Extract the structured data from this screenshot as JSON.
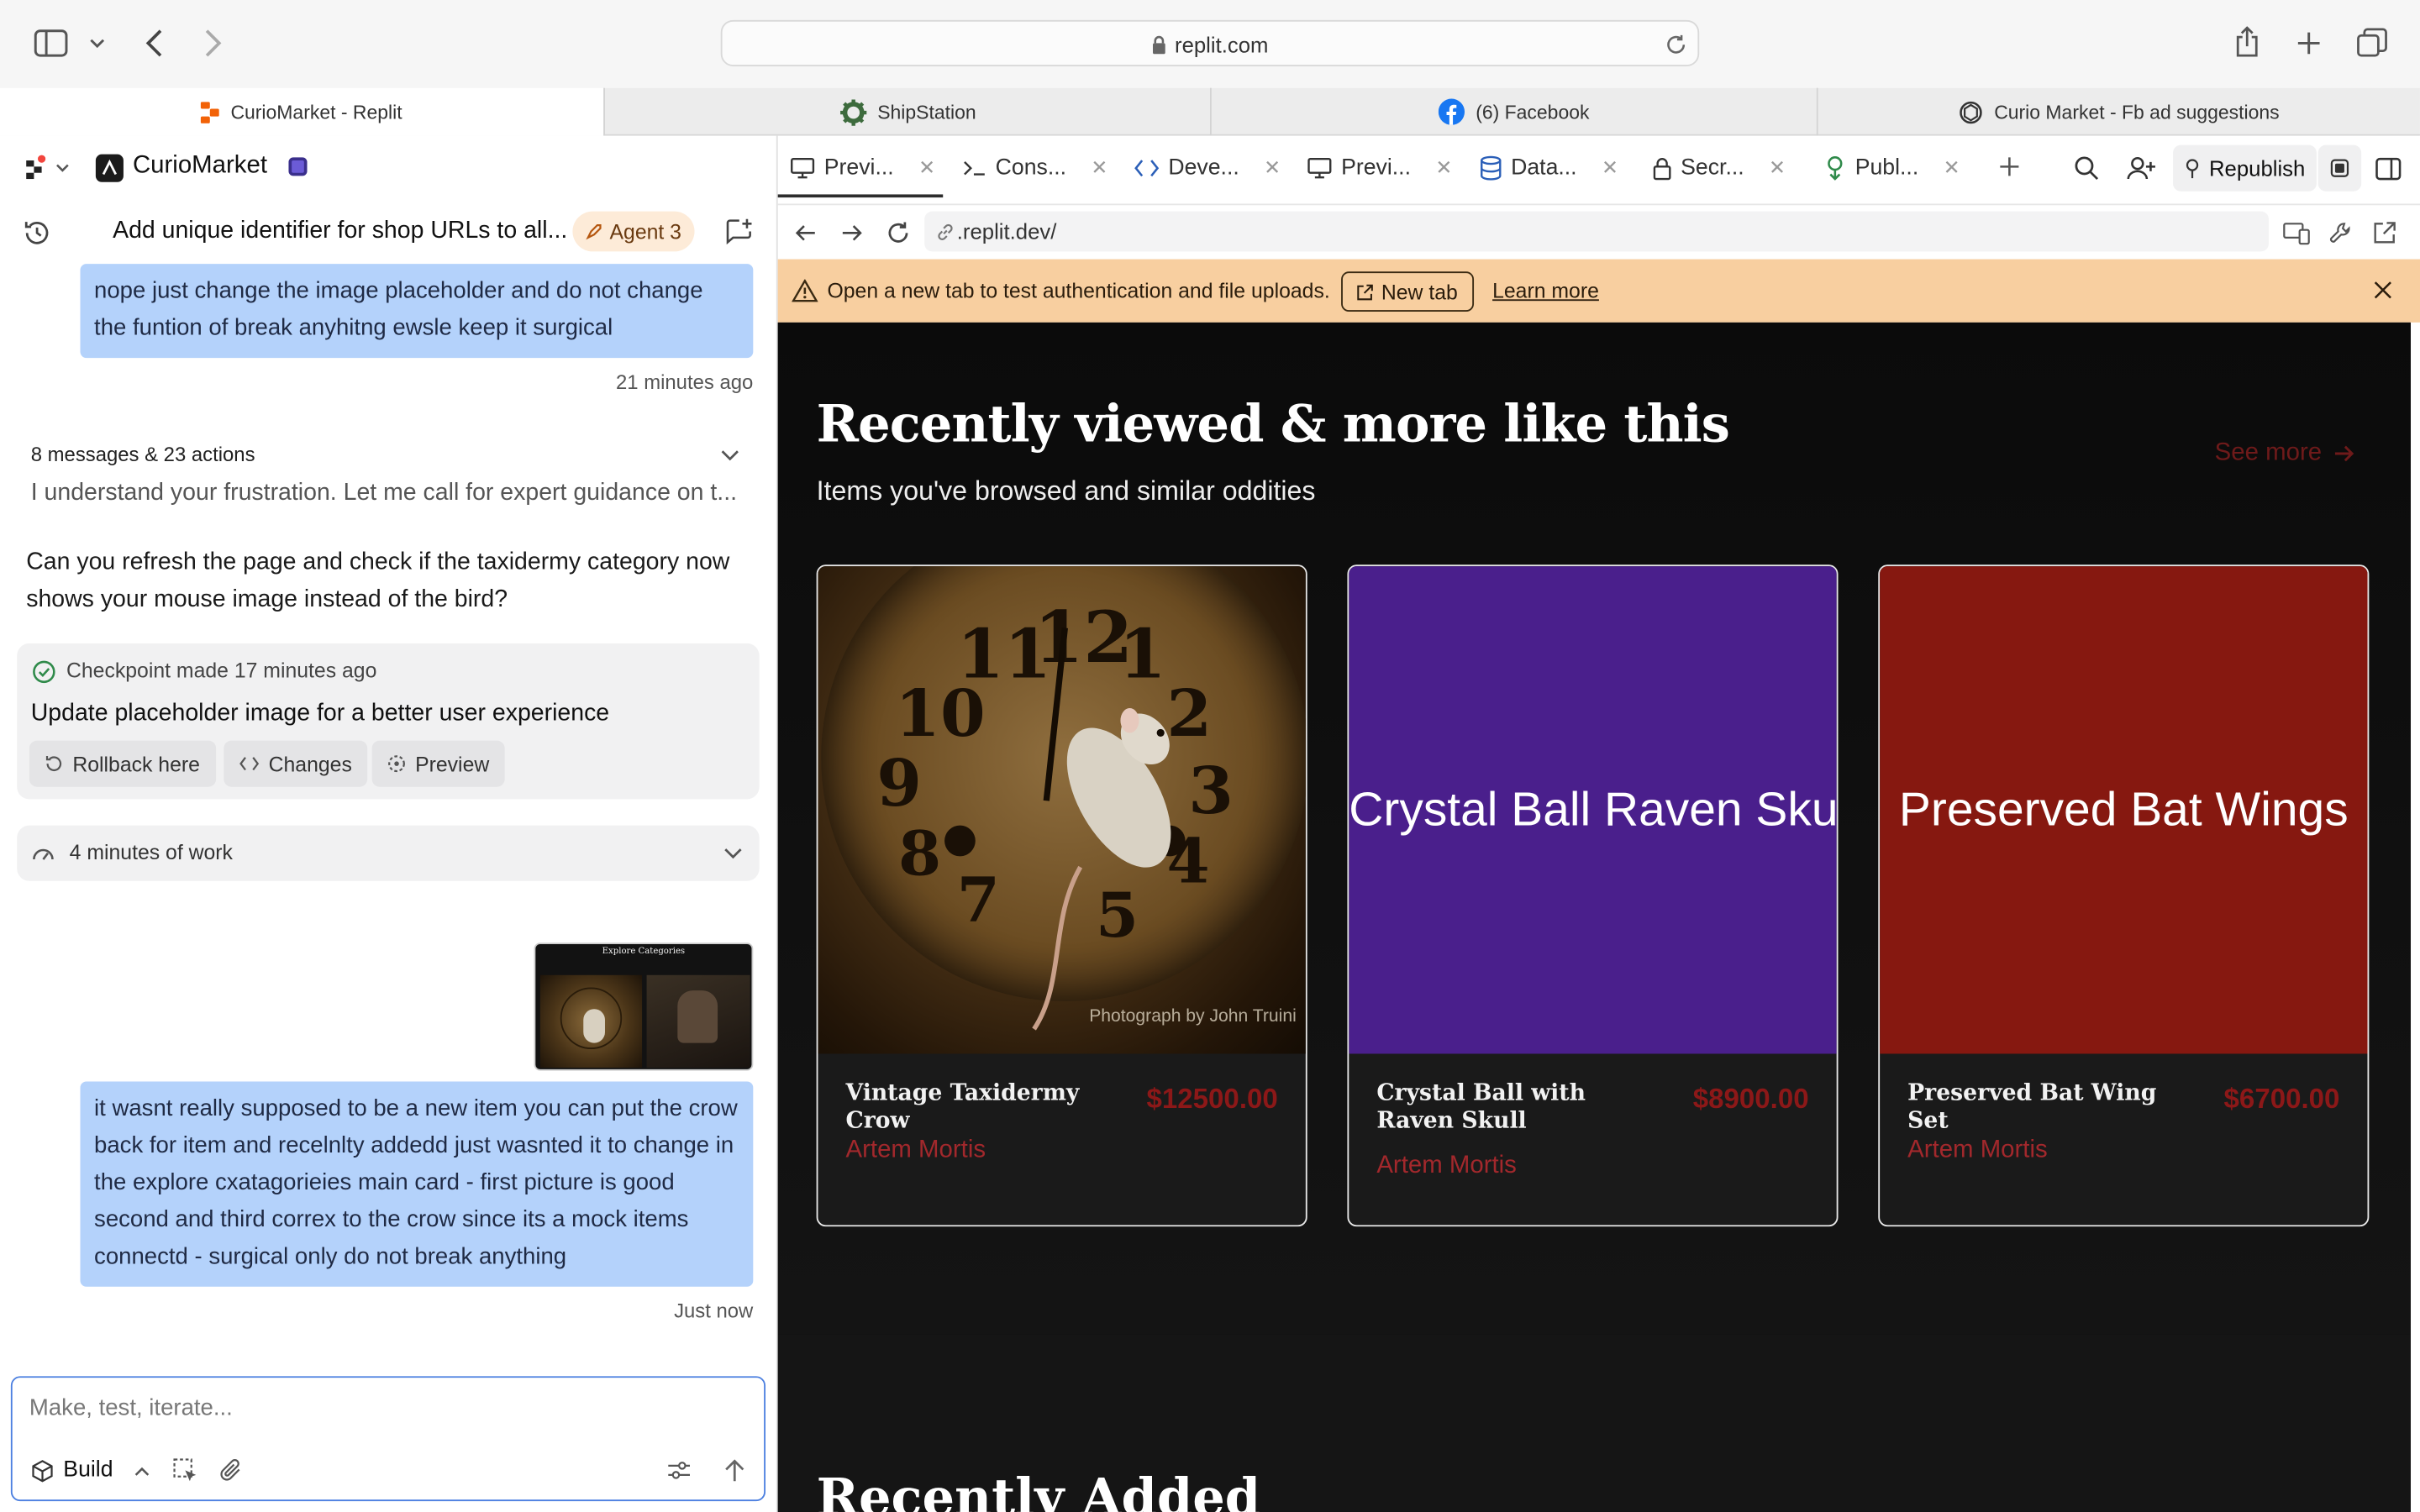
{
  "browser": {
    "url": "replit.com",
    "tabs": [
      {
        "label": "CurioMarket - Replit",
        "icon": "replit-icon",
        "active": true
      },
      {
        "label": "ShipStation",
        "icon": "gear-icon",
        "active": false
      },
      {
        "label": "(6) Facebook",
        "icon": "facebook-icon",
        "active": false
      },
      {
        "label": "Curio Market - Fb ad suggestions",
        "icon": "openai-icon",
        "active": false
      }
    ]
  },
  "workspace": {
    "project_name": "CurioMarket"
  },
  "chat": {
    "thread_title": "Add unique identifier for shop URLs to all...",
    "agent_badge": "Agent 3",
    "messages": {
      "user1": "nope just change the image placeholder and do not change the funtion of break anyhitng ewsle keep it surgical",
      "user1_time": "21 minutes ago",
      "summary_count": "8 messages & 23 actions",
      "summary_preview": "I understand your frustration. Let me call for expert guidance on t...",
      "agent_text": "Can you refresh the page and check if the taxidermy category now shows your mouse image instead of the bird?",
      "checkpoint_label": "Checkpoint made 17 minutes ago",
      "checkpoint_title": "Update placeholder image for a better user experience",
      "rollback_label": "Rollback here",
      "changes_label": "Changes",
      "preview_label": "Preview",
      "work_label": "4 minutes of work",
      "thumb_title": "Explore Categories",
      "user2": "it wasnt really supposed to be a new item you can put the crow back for item and recelnlty addedd just wasnted it to change in the explore cxatagorieies main card - first picture is good second and third correx to the crow since its a mock items connectd - surgical only do not break anything",
      "user2_time": "Just now"
    },
    "input_placeholder": "Make, test, iterate...",
    "build_label": "Build"
  },
  "workspace_tabs": [
    {
      "label": "Previ...",
      "icon": "monitor-icon"
    },
    {
      "label": "Cons...",
      "icon": "terminal-icon"
    },
    {
      "label": "Deve...",
      "icon": "code-icon"
    },
    {
      "label": "Previ...",
      "icon": "monitor-icon"
    },
    {
      "label": "Data...",
      "icon": "database-icon"
    },
    {
      "label": "Secr...",
      "icon": "lock-icon"
    },
    {
      "label": "Publ...",
      "icon": "publish-icon"
    }
  ],
  "republish_label": "Republish",
  "preview_bar": {
    "url": ".replit.dev/",
    "notice": "Open a new tab to test authentication and file uploads.",
    "new_tab_label": "New tab",
    "learn_more_label": "Learn more"
  },
  "site": {
    "section_title": "Recently viewed & more like this",
    "section_subtitle": "Items you've browsed and similar oddities",
    "see_more": "See more",
    "products": [
      {
        "title": "Vintage Taxidermy Crow",
        "price": "$12500.00",
        "seller": "Artem Mortis",
        "image_caption": "Photograph by John Truini",
        "image_kind": "photo"
      },
      {
        "title": "Crystal Ball with Raven Skull",
        "price": "$8900.00",
        "seller": "Artem Mortis",
        "image_text": "Crystal Ball Raven Skull",
        "image_color": "#4a1f8c"
      },
      {
        "title": "Preserved Bat Wing Set",
        "price": "$6700.00",
        "seller": "Artem Mortis",
        "image_text": "Preserved Bat Wings",
        "image_color": "#861810"
      }
    ],
    "next_section_title": "Recently Added"
  },
  "colors": {
    "bubble": "#b4d2fb",
    "notice_bg": "#f8cfa0",
    "price": "#8c1818",
    "seller": "#a2282c",
    "see_more": "#6e1a1a"
  }
}
